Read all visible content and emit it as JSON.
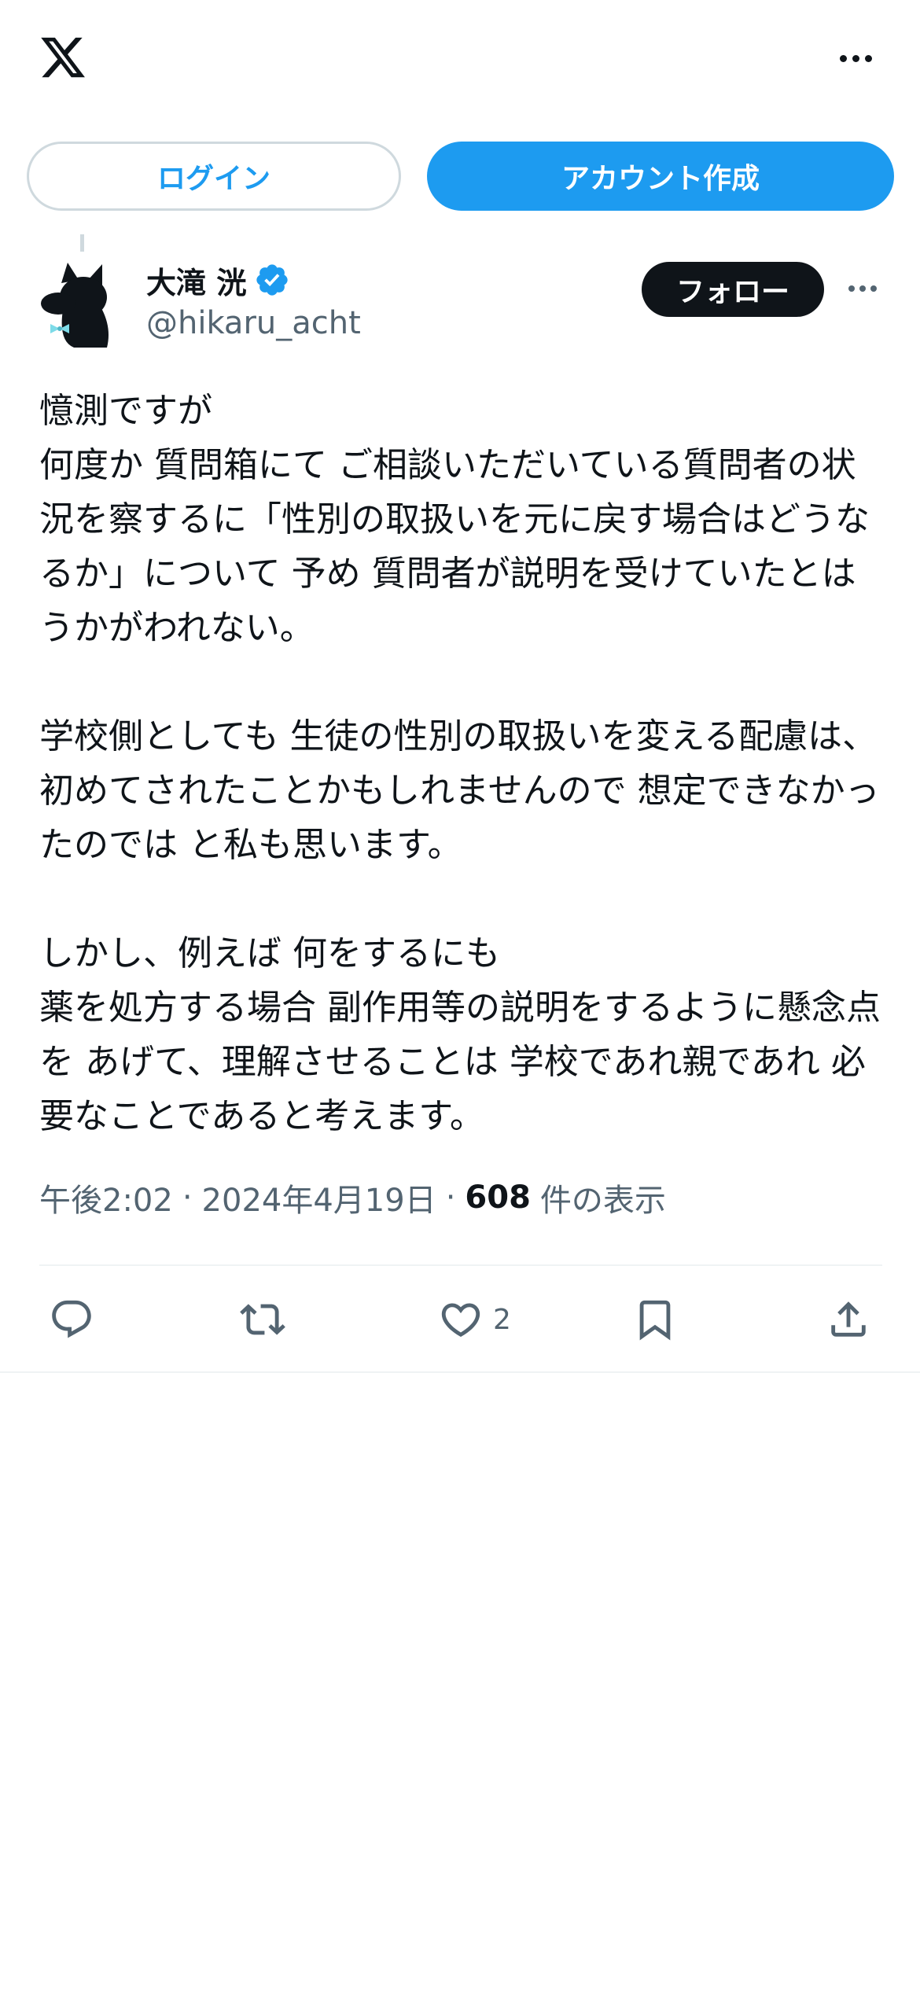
{
  "header": {
    "logo_icon": "x-logo-icon",
    "more_icon": "more-horizontal-icon"
  },
  "auth": {
    "login_label": "ログイン",
    "signup_label": "アカウント作成"
  },
  "tweet": {
    "author": {
      "display_name": "大滝 洸",
      "handle": "@hikaru_acht",
      "verified": true,
      "avatar_icon": "black-cat-avatar"
    },
    "follow_label": "フォロー",
    "text": "憶測ですが\n何度か 質問箱にて ご相談いただいている質問者の状況を察するに「性別の取扱いを元に戻す場合はどうなるか」について 予め 質問者が説明を受けていたとは うかがわれない。\n\n学校側としても 生徒の性別の取扱いを変える配慮は、初めてされたことかもしれませんので 想定できなかったのでは と私も思います。\n\nしかし、例えば 何をするにも\n薬を処方する場合 副作用等の説明をするように懸念点を あげて、理解させることは 学校であれ親であれ 必要なことであると考えます。",
    "time": "午後2:02",
    "separator": "·",
    "date": "2024年4月19日",
    "views_count": "608",
    "views_label": "件の表示",
    "actions": {
      "reply_icon": "reply-icon",
      "retweet_icon": "retweet-icon",
      "like_icon": "heart-icon",
      "like_count": "2",
      "bookmark_icon": "bookmark-icon",
      "share_icon": "share-icon"
    }
  },
  "colors": {
    "accent": "#1d9bf0",
    "text_primary": "#0f1419",
    "text_secondary": "#536471",
    "border": "#cfd9de",
    "divider": "#eff3f4"
  }
}
